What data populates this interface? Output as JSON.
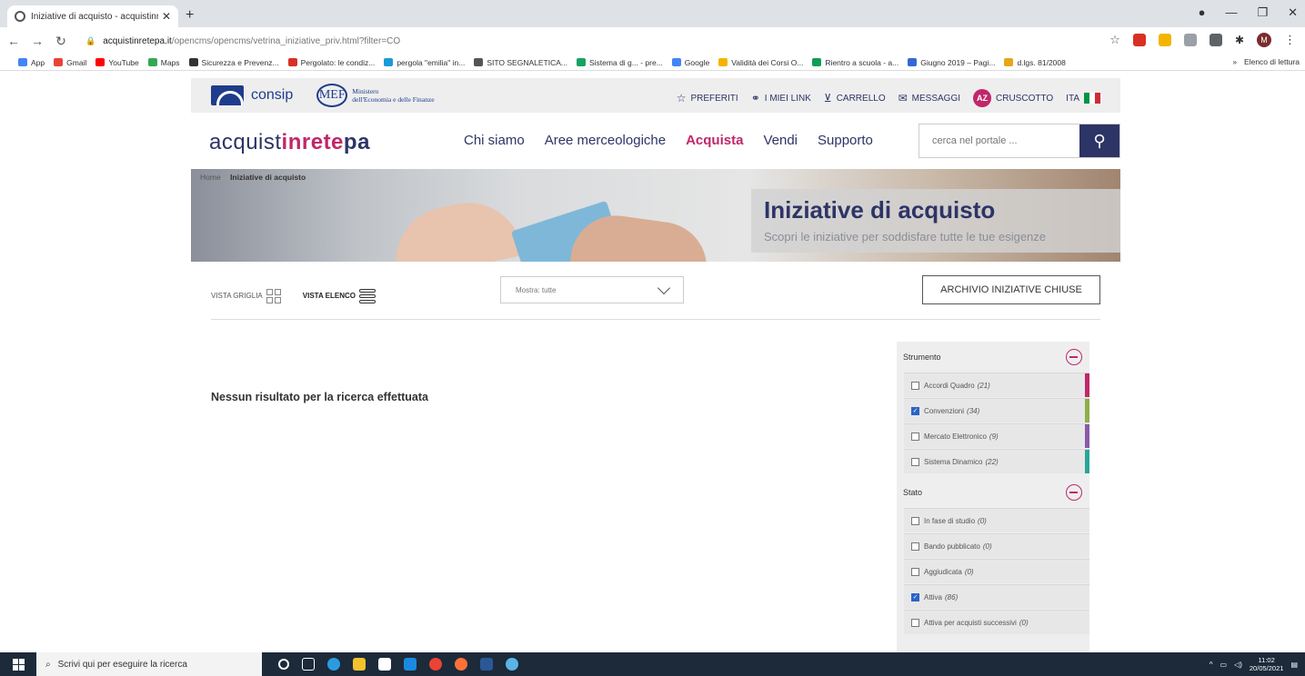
{
  "browser": {
    "tab_title": "Iniziative di acquisto - acquistinr",
    "url_host": "acquistinretepa.it",
    "url_path": "/opencms/opencms/vetrina_iniziative_priv.html?filter=CO",
    "profile_letter": "M"
  },
  "bookmarks": {
    "items": [
      "App",
      "Gmail",
      "YouTube",
      "Maps",
      "Sicurezza e Prevenz...",
      "Pergolato: le condiz...",
      "pergola \"emilia\" in...",
      "SITO SEGNALETICA...",
      "Sistema di g... - pre...",
      "Google",
      "Validità dei Corsi O...",
      "Rientro a scuola - a...",
      "Giugno 2019 – Pagi...",
      "d.lgs. 81/2008"
    ],
    "more": "»",
    "reading_list": "Elenco di lettura"
  },
  "topbar": {
    "consip": "consip",
    "mef_short": "MEF",
    "mef_line1": "Ministero",
    "mef_line2": "dell'Economia e delle Finanze",
    "links": [
      "PREFERITI",
      "I MIEI LINK",
      "CARRELLO",
      "MESSAGGI"
    ],
    "user_initials": "AZ",
    "cruscotto": "CRUSCOTTO",
    "lang": "ITA"
  },
  "header": {
    "brand_a": "acquist",
    "brand_b": "inrete",
    "brand_c": "pa",
    "nav": [
      "Chi siamo",
      "Aree merceologiche",
      "Acquista",
      "Vendi",
      "Supporto"
    ],
    "active_nav": "Acquista",
    "search_placeholder": "cerca nel portale ..."
  },
  "hero": {
    "breadcrumb_home": "Home",
    "breadcrumb_current": "Iniziative di acquisto",
    "title": "Iniziative di acquisto",
    "subtitle": "Scopri le iniziative per soddisfare tutte le tue esigenze"
  },
  "toolbar": {
    "vista_griglia": "VISTA GRIGLIA",
    "vista_elenco": "VISTA ELENCO",
    "select_value": "Mostra: tutte",
    "archivio": "ARCHIVIO INIZIATIVE CHIUSE"
  },
  "main": {
    "no_result": "Nessun risultato per la ricerca effettuata"
  },
  "filters": {
    "strumento": {
      "title": "Strumento",
      "items": [
        {
          "label": "Accordi Quadro",
          "count": "(21)",
          "checked": false,
          "color": "#c0276a"
        },
        {
          "label": "Convenzioni",
          "count": "(34)",
          "checked": true,
          "color": "#8db04a"
        },
        {
          "label": "Mercato Elettronico",
          "count": "(9)",
          "checked": false,
          "color": "#8a5aa8"
        },
        {
          "label": "Sistema Dinamico",
          "count": "(22)",
          "checked": false,
          "color": "#2aa59a"
        }
      ]
    },
    "stato": {
      "title": "Stato",
      "items": [
        {
          "label": "In fase di studio",
          "count": "(0)",
          "checked": false
        },
        {
          "label": "Bando pubblicato",
          "count": "(0)",
          "checked": false
        },
        {
          "label": "Aggiudicata",
          "count": "(0)",
          "checked": false
        },
        {
          "label": "Attiva",
          "count": "(86)",
          "checked": true
        },
        {
          "label": "Attiva per acquisti successivi",
          "count": "(0)",
          "checked": false
        }
      ]
    }
  },
  "taskbar": {
    "search_placeholder": "Scrivi qui per eseguire la ricerca",
    "time": "11:02",
    "date": "20/05/2021"
  }
}
